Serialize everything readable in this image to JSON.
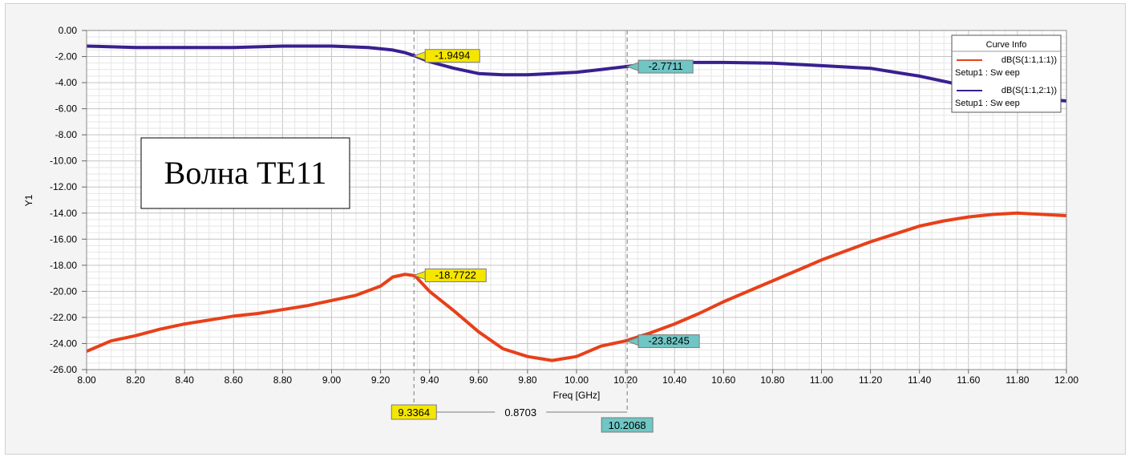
{
  "chart_data": {
    "type": "line",
    "xlabel": "Freq [GHz]",
    "ylabel": "Y1",
    "xlim": [
      8.0,
      12.0
    ],
    "ylim": [
      -26.0,
      0.0
    ],
    "x_ticks": [
      "8.00",
      "8.20",
      "8.40",
      "8.60",
      "8.80",
      "9.00",
      "9.20",
      "9.40",
      "9.60",
      "9.80",
      "10.00",
      "10.20",
      "10.40",
      "10.60",
      "10.80",
      "11.00",
      "11.20",
      "11.40",
      "11.60",
      "11.80",
      "12.00"
    ],
    "y_ticks": [
      "0.00",
      "-2.00",
      "-4.00",
      "-6.00",
      "-8.00",
      "-10.00",
      "-12.00",
      "-14.00",
      "-16.00",
      "-18.00",
      "-20.00",
      "-22.00",
      "-24.00",
      "-26.00"
    ],
    "grid": true,
    "legend": {
      "title": "Curve Info",
      "placement": "top-right",
      "entries": [
        {
          "label": "dB(S(1:1,1:1))",
          "sub": "Setup1 : Sw eep",
          "color": "#e8401a"
        },
        {
          "label": "dB(S(1:1,2:1))",
          "sub": "Setup1 : Sw eep",
          "color": "#3a1f8f"
        }
      ]
    },
    "series": [
      {
        "color": "#e8401a",
        "x": [
          8.0,
          8.1,
          8.2,
          8.3,
          8.4,
          8.5,
          8.6,
          8.7,
          8.8,
          8.9,
          9.0,
          9.1,
          9.2,
          9.25,
          9.3,
          9.34,
          9.4,
          9.5,
          9.6,
          9.7,
          9.8,
          9.9,
          10.0,
          10.1,
          10.2,
          10.3,
          10.4,
          10.5,
          10.6,
          10.7,
          10.8,
          10.9,
          11.0,
          11.1,
          11.2,
          11.3,
          11.4,
          11.5,
          11.6,
          11.7,
          11.8,
          11.9,
          12.0
        ],
        "y": [
          -24.6,
          -23.8,
          -23.4,
          -22.9,
          -22.5,
          -22.2,
          -21.9,
          -21.7,
          -21.4,
          -21.1,
          -20.7,
          -20.3,
          -19.6,
          -18.9,
          -18.7,
          -18.8,
          -20.0,
          -21.5,
          -23.1,
          -24.4,
          -25.0,
          -25.3,
          -25.0,
          -24.2,
          -23.8,
          -23.2,
          -22.5,
          -21.7,
          -20.8,
          -20.0,
          -19.2,
          -18.4,
          -17.6,
          -16.9,
          -16.2,
          -15.6,
          -15.0,
          -14.6,
          -14.3,
          -14.1,
          -14.0,
          -14.1,
          -14.2
        ]
      },
      {
        "color": "#3a1f8f",
        "x": [
          8.0,
          8.2,
          8.4,
          8.6,
          8.8,
          9.0,
          9.15,
          9.25,
          9.3,
          9.34,
          9.4,
          9.5,
          9.6,
          9.7,
          9.8,
          9.9,
          10.0,
          10.1,
          10.2,
          10.3,
          10.4,
          10.6,
          10.8,
          11.0,
          11.2,
          11.3,
          11.4,
          11.5,
          11.6,
          11.7,
          11.8,
          12.0
        ],
        "y": [
          -1.2,
          -1.3,
          -1.3,
          -1.3,
          -1.2,
          -1.2,
          -1.3,
          -1.5,
          -1.7,
          -1.95,
          -2.4,
          -2.9,
          -3.3,
          -3.4,
          -3.4,
          -3.3,
          -3.2,
          -3.0,
          -2.77,
          -2.55,
          -2.45,
          -2.45,
          -2.5,
          -2.7,
          -2.9,
          -3.2,
          -3.5,
          -3.9,
          -4.3,
          -4.7,
          -5.1,
          -5.4
        ]
      }
    ],
    "markers": [
      {
        "x": 9.3364,
        "label": "9.3364",
        "color": "#f5e600"
      },
      {
        "x": 10.2068,
        "label": "10.2068",
        "color": "#6fc6c4"
      }
    ],
    "delta_label": "0.8703",
    "marker_values": [
      {
        "x": 9.3364,
        "y": -1.9494,
        "label": "-1.9494",
        "color": "#f5e600"
      },
      {
        "x": 10.2068,
        "y": -2.7711,
        "label": "-2.7711",
        "color": "#6fc6c4"
      },
      {
        "x": 9.3364,
        "y": -18.7722,
        "label": "-18.7722",
        "color": "#f5e600"
      },
      {
        "x": 10.2068,
        "y": -23.8245,
        "label": "-23.8245",
        "color": "#6fc6c4"
      }
    ],
    "annotation": "Волна TE11"
  }
}
